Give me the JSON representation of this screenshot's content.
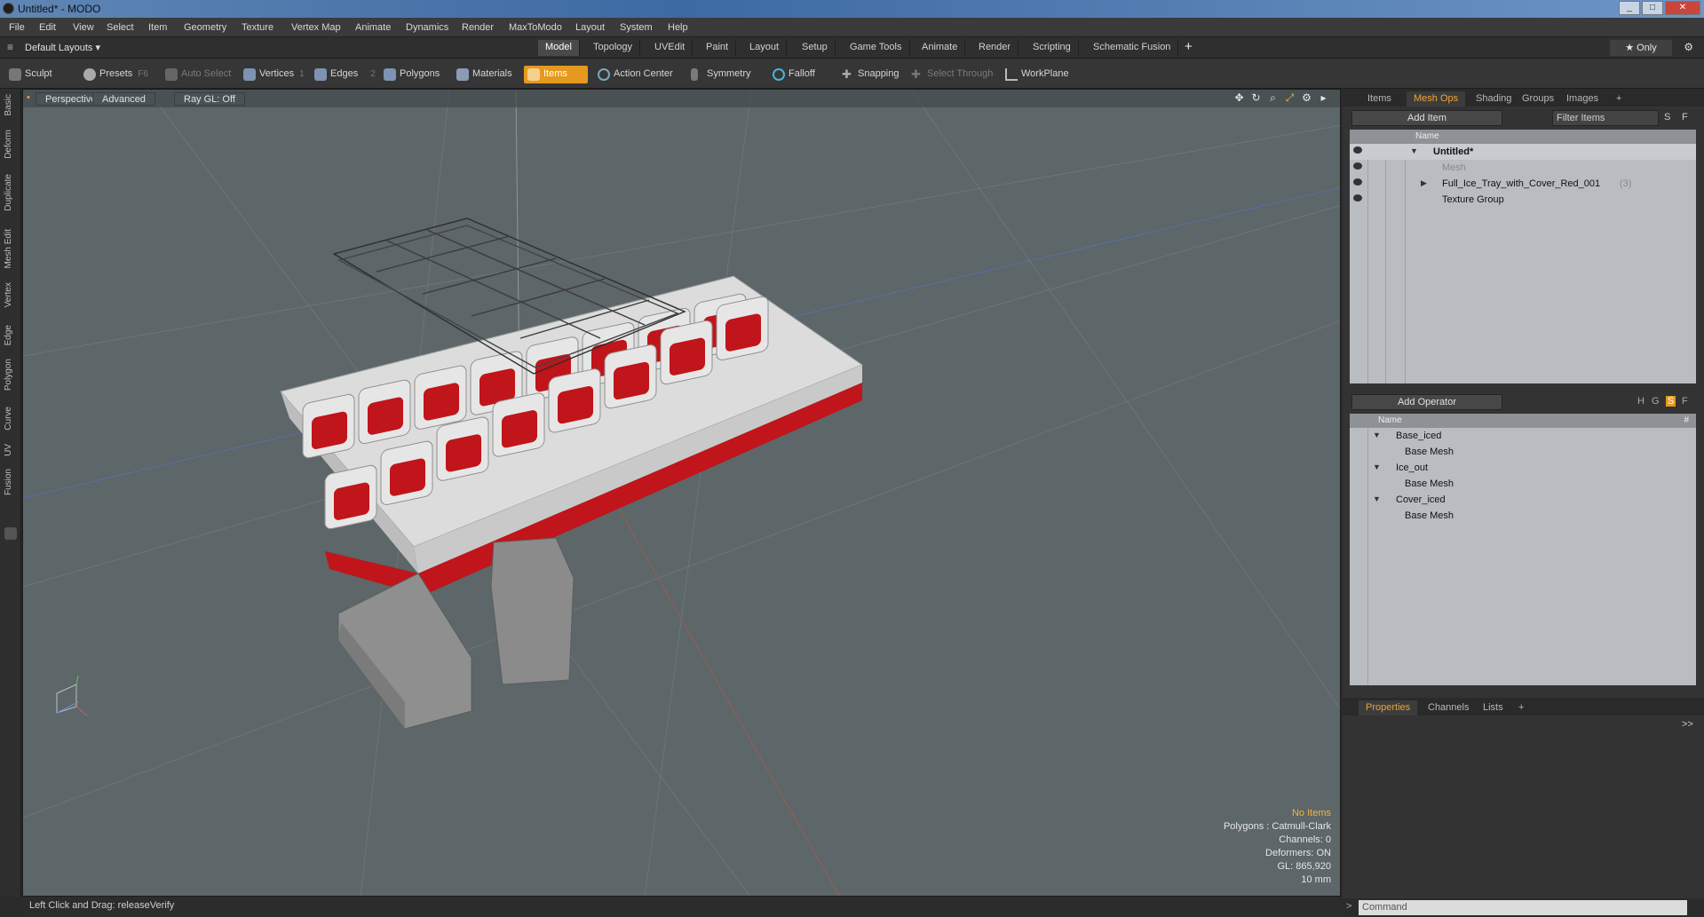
{
  "window": {
    "title": "Untitled* - MODO",
    "controls": [
      "_",
      "□",
      "✕"
    ]
  },
  "menubar": [
    "File",
    "Edit",
    "View",
    "Select",
    "Item",
    "Geometry",
    "Texture",
    "Vertex Map",
    "Animate",
    "Dynamics",
    "Render",
    "MaxToModo",
    "Layout",
    "System",
    "Help"
  ],
  "layoutbar": {
    "layout_selector": "Default Layouts ▾",
    "tabs": [
      "Model",
      "Topology",
      "UVEdit",
      "Paint",
      "Layout",
      "Setup",
      "Game Tools",
      "Animate",
      "Render",
      "Scripting",
      "Schematic Fusion"
    ],
    "active_tab": "Model",
    "add": "+",
    "only_label": "★ Only"
  },
  "toolbar": {
    "sculpt": "Sculpt",
    "presets": "Presets",
    "presets_key": "F6",
    "auto_select": "Auto Select",
    "vertices": "Vertices",
    "vertices_key": "1",
    "edges": "Edges",
    "edges_key": "2",
    "polygons": "Polygons",
    "materials": "Materials",
    "items": "Items",
    "action_center": "Action Center",
    "symmetry": "Symmetry",
    "falloff": "Falloff",
    "snapping": "Snapping",
    "select_through": "Select Through",
    "workplane": "WorkPlane"
  },
  "left_tabs": [
    "Basic",
    "Deform",
    "Duplicate",
    "Mesh Edit",
    "Vertex",
    "Edge",
    "Polygon",
    "Curve",
    "UV",
    "Fusion"
  ],
  "viewport": {
    "tabs": [
      "Perspective",
      "Advanced",
      "Ray GL: Off"
    ],
    "info": {
      "selection": "No Items",
      "polygons": "Polygons : Catmull-Clark",
      "channels": "Channels: 0",
      "deformers": "Deformers: ON",
      "gl": "GL: 865,920",
      "scale": "10 mm"
    },
    "colors": {
      "background": "#5d6669",
      "tray_red": "#c0151a",
      "tray_white": "#e6e6e6"
    }
  },
  "statusbar": {
    "text": "Left Click and Drag:  releaseVerify"
  },
  "items_panel": {
    "tabs": [
      "Items",
      "Mesh Ops",
      "Shading",
      "Groups",
      "Images",
      "+"
    ],
    "active_tab": "Mesh Ops",
    "add_item": "Add Item",
    "filter_placeholder": "Filter Items",
    "filter_s": "S",
    "filter_f": "F",
    "column_name": "Name",
    "rows": [
      {
        "label": "Untitled*",
        "count": ""
      },
      {
        "label": "Mesh",
        "count": ""
      },
      {
        "label": "Full_Ice_Tray_with_Cover_Red_001",
        "count": "(3)"
      },
      {
        "label": "Texture Group",
        "count": ""
      }
    ]
  },
  "meshops_panel": {
    "add_operator": "Add Operator",
    "flags": [
      "H",
      "G",
      "S",
      "F"
    ],
    "column_name": "Name",
    "column_hash": "#",
    "rows": [
      {
        "label": "Base_iced",
        "child": "Base Mesh"
      },
      {
        "label": "Ice_out",
        "child": "Base Mesh"
      },
      {
        "label": "Cover_iced",
        "child": "Base Mesh"
      }
    ]
  },
  "bottom_panel": {
    "tabs": [
      "Properties",
      "Channels",
      "Lists",
      "+"
    ],
    "active_tab": "Properties",
    "expand": ">>"
  },
  "command": {
    "placeholder": "Command"
  }
}
